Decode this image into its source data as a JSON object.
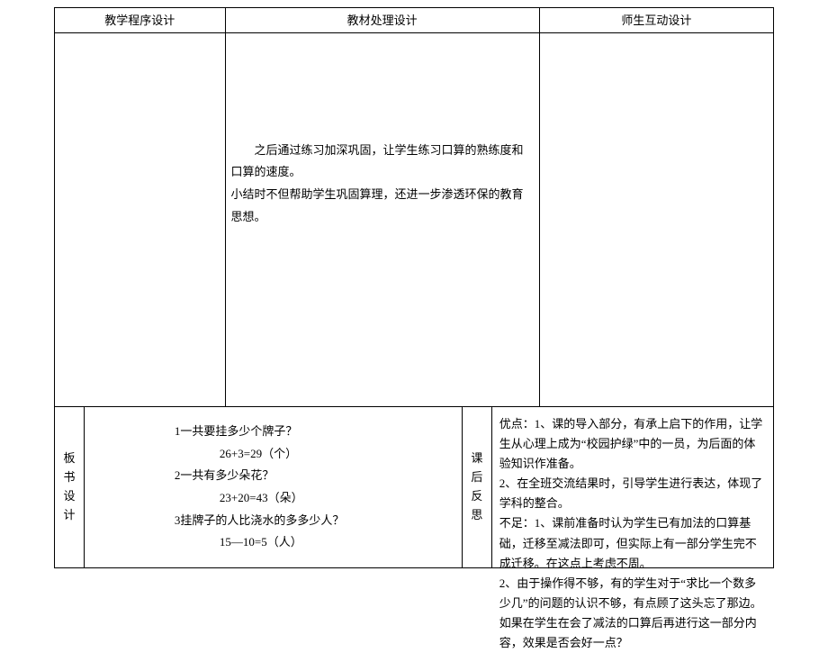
{
  "header": {
    "c1": "教学程序设计",
    "c2": "教材处理设计",
    "c3": "师生互动设计"
  },
  "body": {
    "c2": {
      "p1": "之后通过练习加深巩固，让学生练习口算的熟练度和口算的速度。",
      "p2": "小结时不但帮助学生巩固算理，还进一步渗透环保的教育思想。"
    }
  },
  "footer": {
    "label1": "板书设计",
    "label2": "课后反思",
    "left": {
      "l1": "1一共要挂多少个牌子？",
      "e1": "26+3=29（个）",
      "l2": "2一共有多少朵花？",
      "e2": "23+20=43（朵）",
      "l3": "3挂牌子的人比浇水的多多少人？",
      "e3": "15—10=5（人）"
    },
    "right": {
      "p1": "优点：1、课的导入部分，有承上启下的作用，让学生从心理上成为“校园护绿”中的一员，为后面的体验知识作准备。",
      "p2": "2、在全班交流结果时，引导学生进行表达，体现了学科的整合。",
      "p3": "不足：1、课前准备时认为学生已有加法的口算基础，迁移至减法即可，但实际上有一部分学生完不成迁移。在这点上考虑不周。",
      "p4": "2、由于操作得不够，有的学生对于“求比一个数多少几”的问题的认识不够，有点顾了这头忘了那边。如果在学生在会了减法的口算后再进行这一部分内容，效果是否会好一点？"
    }
  }
}
